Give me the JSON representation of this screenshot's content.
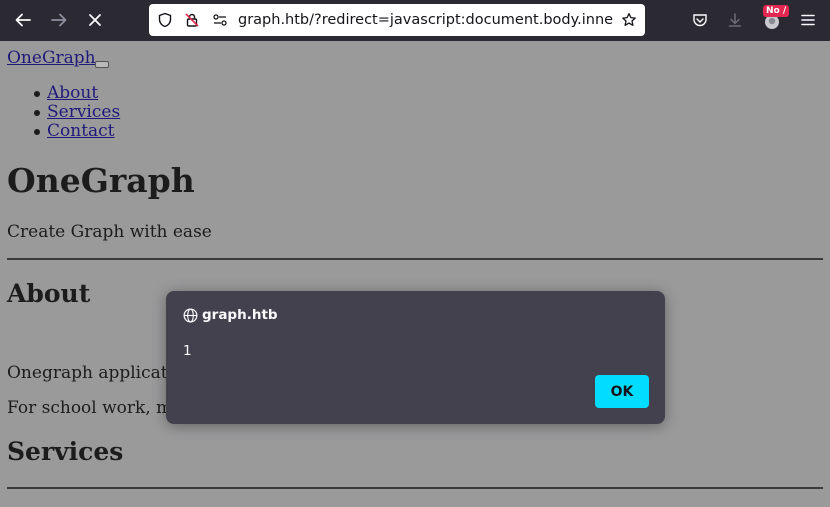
{
  "browser": {
    "url": "graph.htb/?redirect=javascript:document.body.innerH",
    "badge": "No /"
  },
  "page": {
    "brand": "OneGraph",
    "nav": [
      "About",
      "Services",
      "Contact"
    ],
    "heading": "OneGraph",
    "lead": "Create Graph with ease",
    "about_heading": "About",
    "about_p1": "Onegraph applicatio",
    "about_p2": "For school work, me",
    "services_heading": "Services"
  },
  "dialog": {
    "title": "graph.htb",
    "message": "1",
    "ok_label": "OK"
  },
  "colors": {
    "toolbar": "#2b2a33",
    "dialog": "#42414d",
    "ok_button": "#00ddff",
    "page_overlay": "#9a9a9b"
  }
}
